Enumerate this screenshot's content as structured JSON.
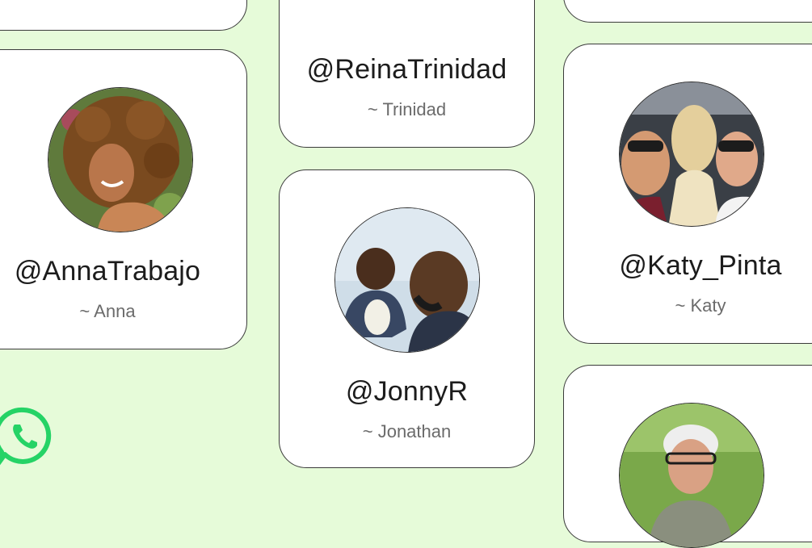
{
  "profiles": [
    {
      "handle": "@ReinaTrinidad",
      "name": "~ Trinidad"
    },
    {
      "handle": "@AnnaTrabajo",
      "name": "~ Anna"
    },
    {
      "handle": "@JonnyR",
      "name": "~ Jonathan"
    },
    {
      "handle": "@Katy_Pinta",
      "name": "~ Katy"
    }
  ],
  "colors": {
    "background": "#e6fbd9",
    "card": "#ffffff",
    "whatsapp_green": "#25d366"
  },
  "icons": {
    "brand": "whatsapp-icon"
  }
}
